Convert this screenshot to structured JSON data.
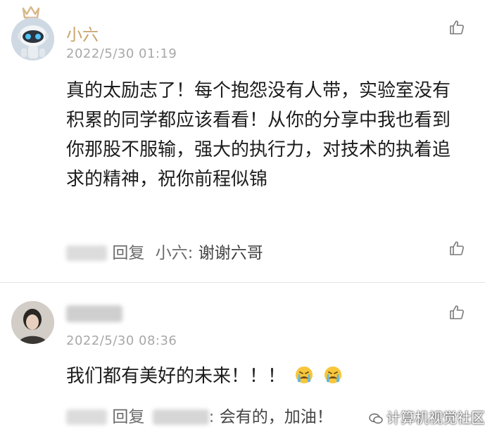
{
  "comments": [
    {
      "author": "小六",
      "timestamp": "2022/5/30 01:19",
      "content": "真的太励志了！每个抱怨没有人带，实验室没有积累的同学都应该看看！从你的分享中我也看到你那股不服输，强大的执行力，对技术的执着追求的精神，祝你前程似锦",
      "reply": {
        "label": "回复",
        "to": "小六",
        "sep": ":",
        "text": "谢谢六哥"
      },
      "crown_color": "#d8b88a"
    },
    {
      "author": "",
      "timestamp": "2022/5/30 08:36",
      "content": "我们都有美好的未来！！！",
      "emojis": [
        "crying-face-icon",
        "crying-face-icon"
      ],
      "reply": {
        "label": "回复",
        "sep": ":",
        "text": "会有的，加油！"
      }
    }
  ],
  "watermark": "计算机视觉社区"
}
